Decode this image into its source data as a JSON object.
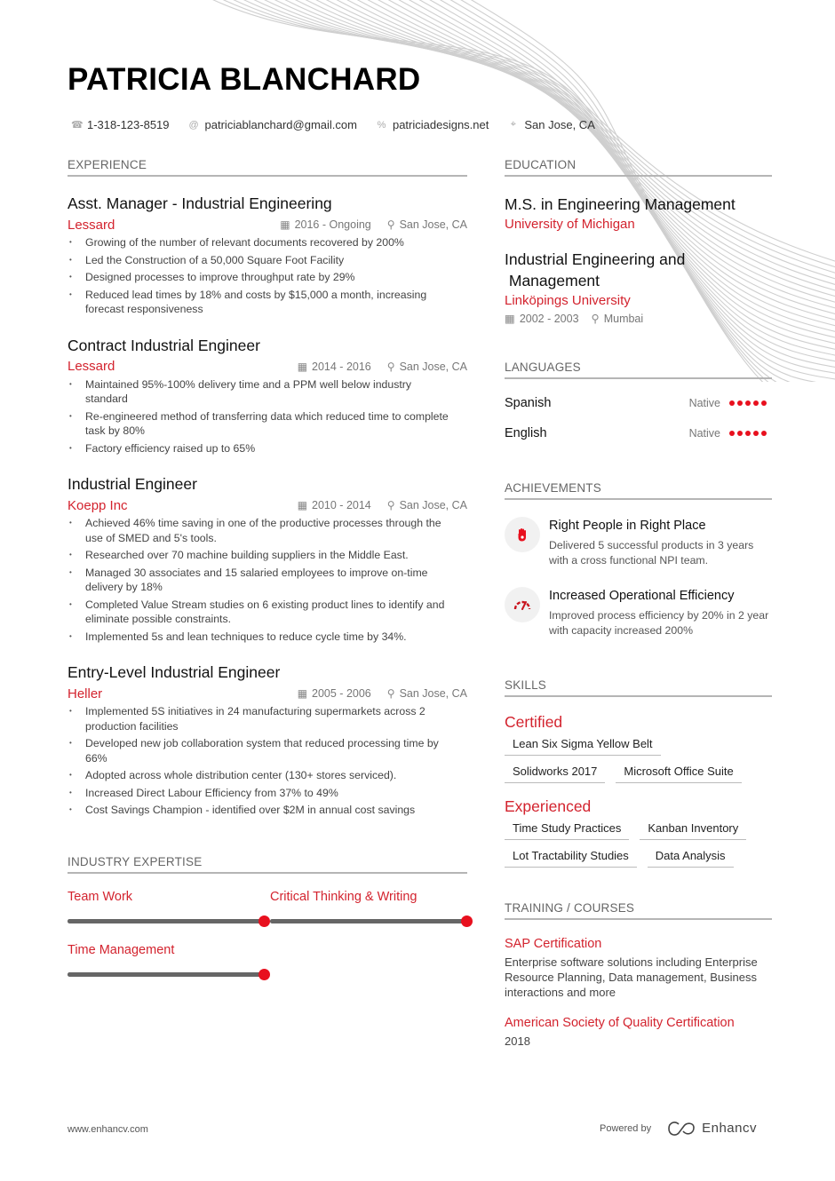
{
  "header": {
    "name": "PATRICIA BLANCHARD",
    "contacts": [
      {
        "icon": "phone-icon",
        "glyph": "☎",
        "text": "1-318-123-8519"
      },
      {
        "icon": "at-icon",
        "glyph": "@",
        "text": "patriciablanchard@gmail.com"
      },
      {
        "icon": "link-icon",
        "glyph": "%",
        "text": "patriciadesigns.net"
      },
      {
        "icon": "location-icon",
        "glyph": "⌖",
        "text": "San Jose, CA"
      }
    ]
  },
  "experience": {
    "title": "EXPERIENCE",
    "jobs": [
      {
        "title": "Asst. Manager - Industrial Engineering",
        "company": "Lessard",
        "dates": "2016 - Ongoing",
        "location": "San Jose, CA",
        "bullets": [
          "Growing of the number of relevant documents recovered by 200%",
          "Led the Construction of a 50,000 Square Foot Facility",
          "Designed processes to improve throughput rate by 29%",
          "Reduced lead times by 18% and costs by $15,000 a month, increasing forecast responsiveness"
        ]
      },
      {
        "title": "Contract Industrial Engineer",
        "company": "Lessard",
        "dates": "2014 - 2016",
        "location": "San Jose, CA",
        "bullets": [
          "Maintained 95%-100% delivery time and a PPM well below industry standard",
          "Re-engineered method of transferring data which reduced time to complete task by 80%",
          "Factory efficiency raised up to 65%"
        ]
      },
      {
        "title": "Industrial Engineer",
        "company": "Koepp Inc",
        "dates": "2010 - 2014",
        "location": "San Jose, CA",
        "bullets": [
          "Achieved 46% time saving in one of the productive processes through the use of SMED and 5's tools.",
          "Researched over 70 machine building suppliers in the Middle East.",
          "Managed 30 associates and 15 salaried employees to improve on-time delivery by 18%",
          "Completed Value Stream studies on 6 existing product lines to identify and eliminate possible constraints.",
          "Implemented 5s and lean techniques to reduce cycle time by 34%."
        ]
      },
      {
        "title": "Entry-Level Industrial Engineer",
        "company": "Heller",
        "dates": "2005 - 2006",
        "location": "San Jose, CA",
        "bullets": [
          "Implemented 5S initiatives in 24 manufacturing supermarkets across 2 production facilities",
          "Developed new job collaboration system that reduced processing time by 66%",
          "Adopted across whole distribution center (130+ stores serviced).",
          "Increased Direct Labour Efficiency from 37% to 49%",
          "Cost Savings Champion - identified over $2M in annual cost savings"
        ]
      }
    ]
  },
  "expertise": {
    "title": "INDUSTRY EXPERTISE",
    "items": [
      {
        "label": "Team Work",
        "level": 1.0
      },
      {
        "label": "Critical Thinking & Writing",
        "level": 1.0
      },
      {
        "label": "Time Management",
        "level": 1.0
      }
    ]
  },
  "education": {
    "title": "EDUCATION",
    "items": [
      {
        "degree": "M.S. in Engineering Management",
        "school": "University of Michigan",
        "dates": "",
        "location": ""
      },
      {
        "degree": "Industrial Engineering and\n Management",
        "school": "Linköpings University",
        "dates": "2002 - 2003",
        "location": "Mumbai"
      }
    ]
  },
  "languages": {
    "title": "LANGUAGES",
    "items": [
      {
        "name": "Spanish",
        "level": "Native",
        "dots": 5,
        "max": 5
      },
      {
        "name": "English",
        "level": "Native",
        "dots": 5,
        "max": 5
      }
    ]
  },
  "achievements": {
    "title": "ACHIEVEMENTS",
    "items": [
      {
        "icon": "hand-icon",
        "title": "Right People in Right Place",
        "desc": "Delivered 5 successful products in 3 years with a cross functional NPI team."
      },
      {
        "icon": "speedometer-icon",
        "title": "Increased Operational Efficiency",
        "desc": "Improved process efficiency by 20% in 2 year with capacity increased 200%"
      }
    ]
  },
  "skills": {
    "title": "SKILLS",
    "groups": [
      {
        "name": "Certified",
        "rows": [
          [
            "Lean Six Sigma Yellow Belt"
          ],
          [
            "Solidworks 2017",
            "Microsoft Office Suite"
          ]
        ]
      },
      {
        "name": "Experienced",
        "rows": [
          [
            "Time Study Practices",
            "Kanban Inventory"
          ],
          [
            "Lot Tractability Studies",
            "Data Analysis"
          ]
        ]
      }
    ]
  },
  "training": {
    "title": "TRAINING / COURSES",
    "items": [
      {
        "title": "SAP Certification",
        "desc": "Enterprise software solutions including Enterprise Resource Planning, Data management, Business interactions and more"
      },
      {
        "title": "American Society of Quality Certification",
        "desc": "2018"
      }
    ]
  },
  "footer": {
    "website": "www.enhancv.com",
    "powered_by": "Powered by",
    "brand": "Enhancv"
  },
  "colors": {
    "accent": "#d3232e",
    "dot": "#e8101e",
    "bar": "#666666"
  }
}
